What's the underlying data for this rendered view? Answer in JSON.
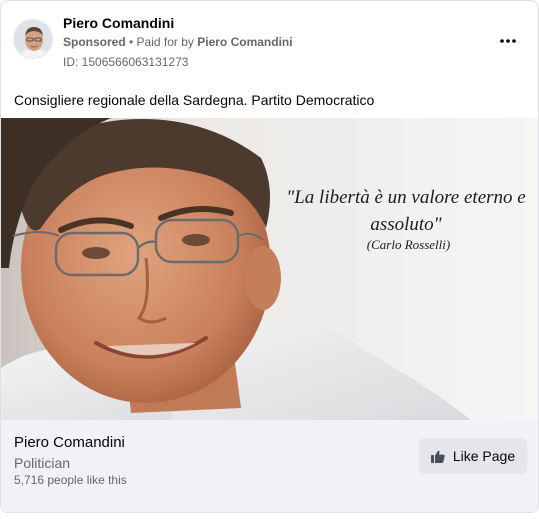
{
  "post": {
    "page_name": "Piero Comandini",
    "sponsored_label": "Sponsored",
    "separator": " • ",
    "paid_for_prefix": "Paid for by ",
    "paid_for_name": "Piero Comandini",
    "ad_id": "ID: 1506566063131273",
    "more_icon": "more-horizontal-icon",
    "body_text": "Consigliere regionale della Sardegna. Partito Democratico"
  },
  "creative": {
    "quote": "\"La libertà è un valore eterno e assoluto\"",
    "quote_author": "(Carlo Rosselli)"
  },
  "footer": {
    "page_name": "Piero Comandini",
    "category": "Politician",
    "likes": "5,716 people like this",
    "like_button_label": "Like Page",
    "like_icon": "thumbs-up-icon"
  },
  "colors": {
    "primary_text": "#050505",
    "secondary_text": "#65676b",
    "footer_bg": "#f0f2f5",
    "button_bg": "#e4e6eb",
    "border": "#dddfe2"
  }
}
